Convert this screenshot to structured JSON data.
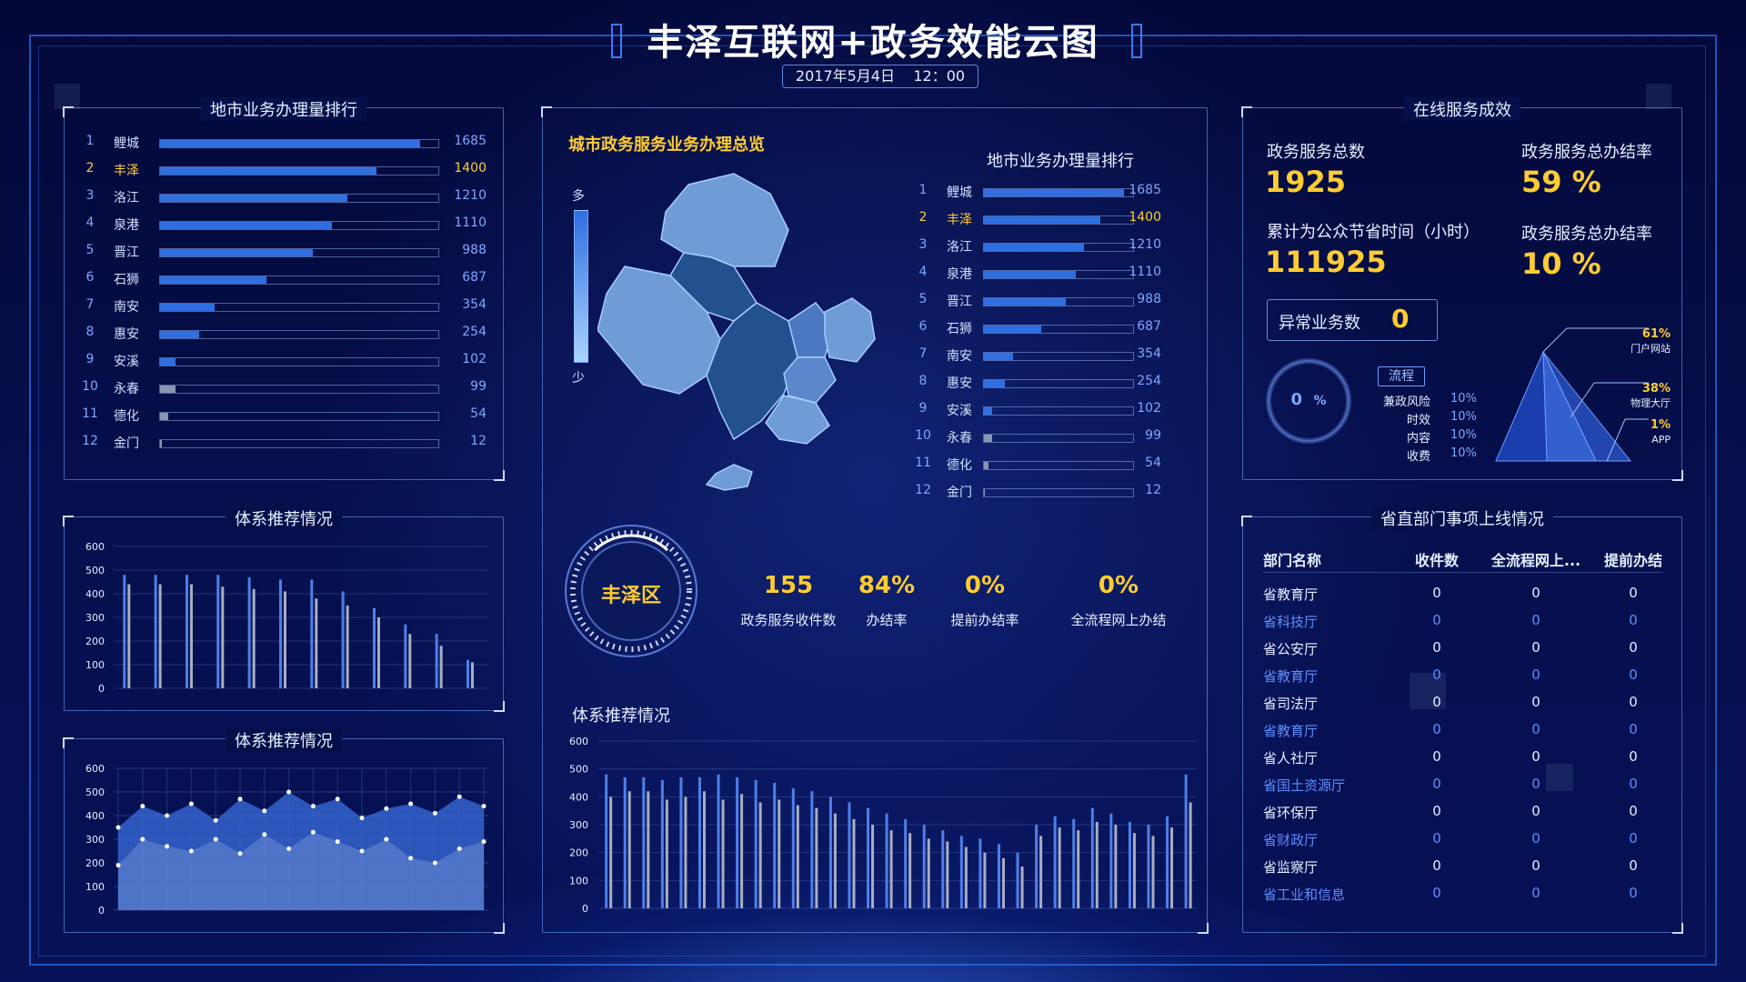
{
  "header": {
    "title": "丰泽互联网+政务效能云图",
    "date": "2017年5月4日",
    "time": "12：00"
  },
  "ranking_panel": {
    "title": "地市业务办理量排行",
    "max": 1800,
    "items": [
      {
        "rank": "1",
        "city": "鲤城",
        "value": 1685
      },
      {
        "rank": "2",
        "city": "丰泽",
        "value": 1400,
        "highlight": true
      },
      {
        "rank": "3",
        "city": "洛江",
        "value": 1210
      },
      {
        "rank": "4",
        "city": "泉港",
        "value": 1110
      },
      {
        "rank": "5",
        "city": "晋江",
        "value": 988
      },
      {
        "rank": "6",
        "city": "石狮",
        "value": 687
      },
      {
        "rank": "7",
        "city": "南安",
        "value": 354
      },
      {
        "rank": "8",
        "city": "惠安",
        "value": 254
      },
      {
        "rank": "9",
        "city": "安溪",
        "value": 102
      },
      {
        "rank": "10",
        "city": "永春",
        "value": 99
      },
      {
        "rank": "11",
        "city": "德化",
        "value": 54
      },
      {
        "rank": "12",
        "city": "金门",
        "value": 12
      }
    ]
  },
  "bar_panel": {
    "title": "体系推荐情况"
  },
  "area_panel": {
    "title": "体系推荐情况"
  },
  "center": {
    "title": "城市政务服务业务办理总览",
    "legend_high": "多",
    "legend_low": "少",
    "ranking_title": "地市业务办理量排行",
    "district": "丰泽区",
    "kpis": [
      {
        "value": "155",
        "label": "政务服务收件数"
      },
      {
        "value": "84%",
        "label": "办结率"
      },
      {
        "value": "0%",
        "label": "提前办结率"
      },
      {
        "value": "0%",
        "label": "全流程网上办结"
      }
    ],
    "chart_title": "体系推荐情况"
  },
  "online": {
    "title": "在线服务成效",
    "total_label": "政务服务总数",
    "total_value": "1925",
    "rate_label": "政务服务总办结率",
    "rate_value": "59 %",
    "saved_label": "累计为公众节省时间（小时）",
    "saved_value": "111925",
    "rate2_label": "政务服务总办结率",
    "rate2_value": "10 %",
    "abnormal_label": "异常业务数",
    "abnormal_value": "0",
    "gauge_value": "0",
    "gauge_unit": "%",
    "flow_tag": "流程",
    "risks": [
      {
        "label": "兼政风险",
        "value": "10%"
      },
      {
        "label": "时效",
        "value": "10%"
      },
      {
        "label": "内容",
        "value": "10%"
      },
      {
        "label": "收费",
        "value": "10%"
      }
    ],
    "pyramid": [
      {
        "pct": "61%",
        "label": "门户网站"
      },
      {
        "pct": "38%",
        "label": "物理大厅"
      },
      {
        "pct": "1%",
        "label": "APP"
      }
    ]
  },
  "dept": {
    "title": "省直部门事项上线情况",
    "headers": [
      "部门名称",
      "收件数",
      "全流程网上...",
      "提前办结"
    ],
    "rows": [
      [
        "省教育厅",
        "0",
        "0",
        "0"
      ],
      [
        "省科技厅",
        "0",
        "0",
        "0"
      ],
      [
        "省公安厅",
        "0",
        "0",
        "0"
      ],
      [
        "省教育厅",
        "0",
        "0",
        "0"
      ],
      [
        "省司法厅",
        "0",
        "0",
        "0"
      ],
      [
        "省教育厅",
        "0",
        "0",
        "0"
      ],
      [
        "省人社厅",
        "0",
        "0",
        "0"
      ],
      [
        "省国土资源厅",
        "0",
        "0",
        "0"
      ],
      [
        "省环保厅",
        "0",
        "0",
        "0"
      ],
      [
        "省财政厅",
        "0",
        "0",
        "0"
      ],
      [
        "省监察厅",
        "0",
        "0",
        "0"
      ],
      [
        "省工业和信息",
        "0",
        "0",
        "0"
      ]
    ]
  },
  "colors": {
    "accent": "#ffcc33",
    "bar_blue": "#2f6fe0",
    "bar_gray": "#8a95b0",
    "frame": "#3a7bff"
  },
  "chart_data": [
    {
      "type": "bar",
      "title": "体系推荐情况",
      "ylim": [
        0,
        600
      ],
      "yticks": [
        0,
        100,
        200,
        300,
        400,
        500,
        600
      ],
      "series": [
        {
          "values": [
            480,
            480,
            480,
            480,
            470,
            460,
            460,
            410,
            340,
            270,
            230,
            120
          ]
        },
        {
          "values": [
            440,
            440,
            440,
            430,
            420,
            410,
            380,
            350,
            300,
            230,
            180,
            110
          ]
        }
      ]
    },
    {
      "type": "area",
      "title": "",
      "ylim": [
        0,
        600
      ],
      "yticks": [
        0,
        100,
        200,
        300,
        400,
        500,
        600
      ],
      "series": [
        {
          "values": [
            350,
            440,
            400,
            450,
            380,
            470,
            420,
            500,
            440,
            470,
            390,
            430,
            450,
            410,
            480,
            440
          ]
        },
        {
          "values": [
            190,
            300,
            270,
            250,
            300,
            240,
            320,
            260,
            330,
            290,
            250,
            300,
            220,
            200,
            260,
            290
          ]
        }
      ]
    },
    {
      "type": "bar",
      "title": "体系推荐情况",
      "ylim": [
        0,
        600
      ],
      "yticks": [
        0,
        100,
        200,
        300,
        400,
        500,
        600
      ],
      "series": [
        {
          "values": [
            480,
            470,
            470,
            460,
            470,
            470,
            480,
            470,
            460,
            450,
            430,
            420,
            400,
            380,
            360,
            340,
            320,
            300,
            280,
            260,
            250,
            230,
            200,
            300,
            330,
            320,
            360,
            340,
            310,
            300,
            330,
            480
          ]
        },
        {
          "values": [
            400,
            420,
            420,
            390,
            400,
            420,
            390,
            410,
            380,
            390,
            370,
            360,
            340,
            320,
            300,
            280,
            270,
            250,
            240,
            220,
            200,
            180,
            150,
            260,
            290,
            280,
            310,
            300,
            270,
            260,
            290,
            380
          ]
        }
      ]
    }
  ]
}
